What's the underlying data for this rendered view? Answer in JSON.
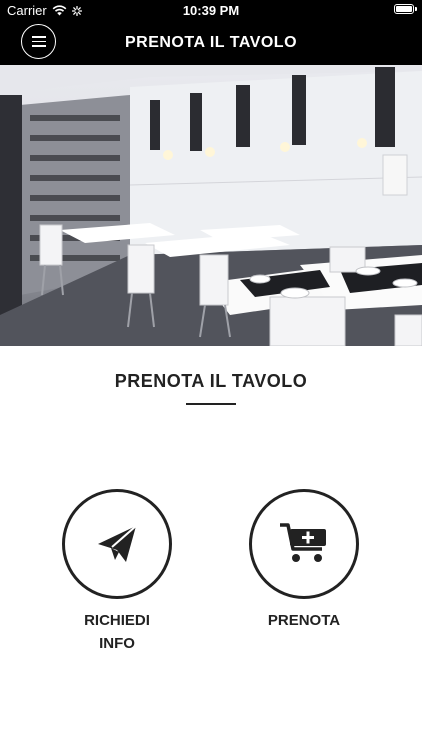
{
  "status_bar": {
    "carrier": "Carrier",
    "time": "10:39 PM"
  },
  "navbar": {
    "title": "PRENOTA IL TAVOLO"
  },
  "content": {
    "title": "PRENOTA IL TAVOLO",
    "actions": [
      {
        "label": "RICHIEDI\nINFO",
        "icon": "paper-plane-icon"
      },
      {
        "label": "PRENOTA",
        "icon": "cart-plus-icon"
      }
    ]
  },
  "colors": {
    "bar_bg": "#000000",
    "text_dark": "#222222",
    "background": "#ffffff"
  }
}
